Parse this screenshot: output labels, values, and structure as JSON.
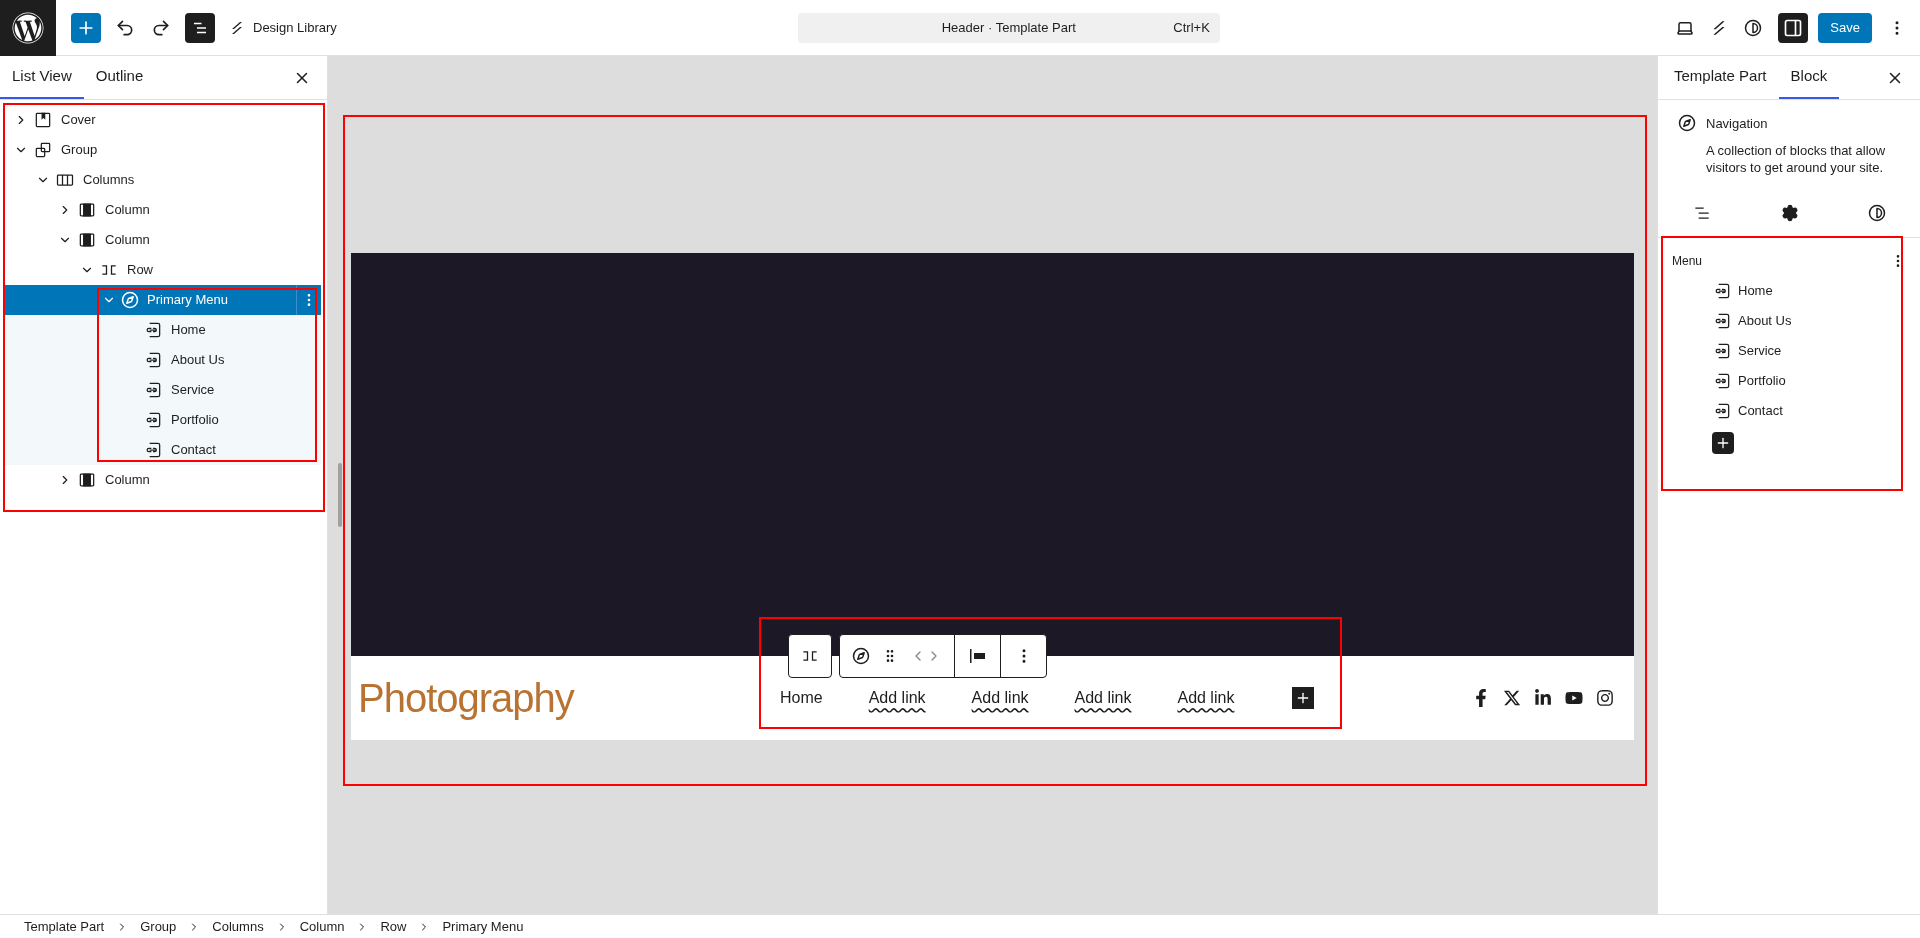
{
  "top_bar": {
    "library_label": "Design Library",
    "document_title": "Header · Template Part",
    "shortcut": "Ctrl+K",
    "save_label": "Save"
  },
  "list_panel": {
    "tabs": [
      {
        "label": "List View",
        "selected": true
      },
      {
        "label": "Outline",
        "selected": false
      }
    ],
    "tree": [
      {
        "label": "Cover",
        "kind": "cover",
        "expanded": false,
        "selected": false
      },
      {
        "label": "Group",
        "kind": "group",
        "expanded": true,
        "selected": false,
        "children": [
          {
            "label": "Columns",
            "kind": "columns",
            "expanded": true,
            "selected": false,
            "children": [
              {
                "label": "Column",
                "kind": "column",
                "expanded": false,
                "selected": false
              },
              {
                "label": "Column",
                "kind": "column",
                "expanded": true,
                "selected": false,
                "children": [
                  {
                    "label": "Row",
                    "kind": "row",
                    "expanded": true,
                    "selected": false,
                    "children": [
                      {
                        "label": "Primary Menu",
                        "kind": "navigation",
                        "expanded": true,
                        "selected": true,
                        "children": [
                          {
                            "label": "Home",
                            "kind": "link",
                            "selected": false
                          },
                          {
                            "label": "About Us",
                            "kind": "link",
                            "selected": false
                          },
                          {
                            "label": "Service",
                            "kind": "link",
                            "selected": false
                          },
                          {
                            "label": "Portfolio",
                            "kind": "link",
                            "selected": false
                          },
                          {
                            "label": "Contact",
                            "kind": "link",
                            "selected": false
                          }
                        ]
                      }
                    ]
                  }
                ]
              },
              {
                "label": "Column",
                "kind": "column",
                "expanded": false,
                "selected": false
              }
            ]
          }
        ]
      }
    ]
  },
  "canvas": {
    "site_title": "Photography",
    "nav_items": [
      {
        "label": "Home",
        "kind": "link"
      },
      {
        "label": "Add link",
        "kind": "placeholder"
      },
      {
        "label": "Add link",
        "kind": "placeholder"
      },
      {
        "label": "Add link",
        "kind": "placeholder"
      },
      {
        "label": "Add link",
        "kind": "placeholder"
      }
    ]
  },
  "settings_panel": {
    "tabs": [
      {
        "label": "Template Part",
        "selected": false
      },
      {
        "label": "Block",
        "selected": true
      }
    ],
    "block": {
      "name": "Navigation",
      "description": "A collection of blocks that allow visitors to get around your site."
    },
    "menu": {
      "label": "Menu",
      "items": [
        "Home",
        "About Us",
        "Service",
        "Portfolio",
        "Contact"
      ]
    }
  },
  "breadcrumbs": [
    "Template Part",
    "Group",
    "Columns",
    "Column",
    "Row",
    "Primary Menu"
  ]
}
